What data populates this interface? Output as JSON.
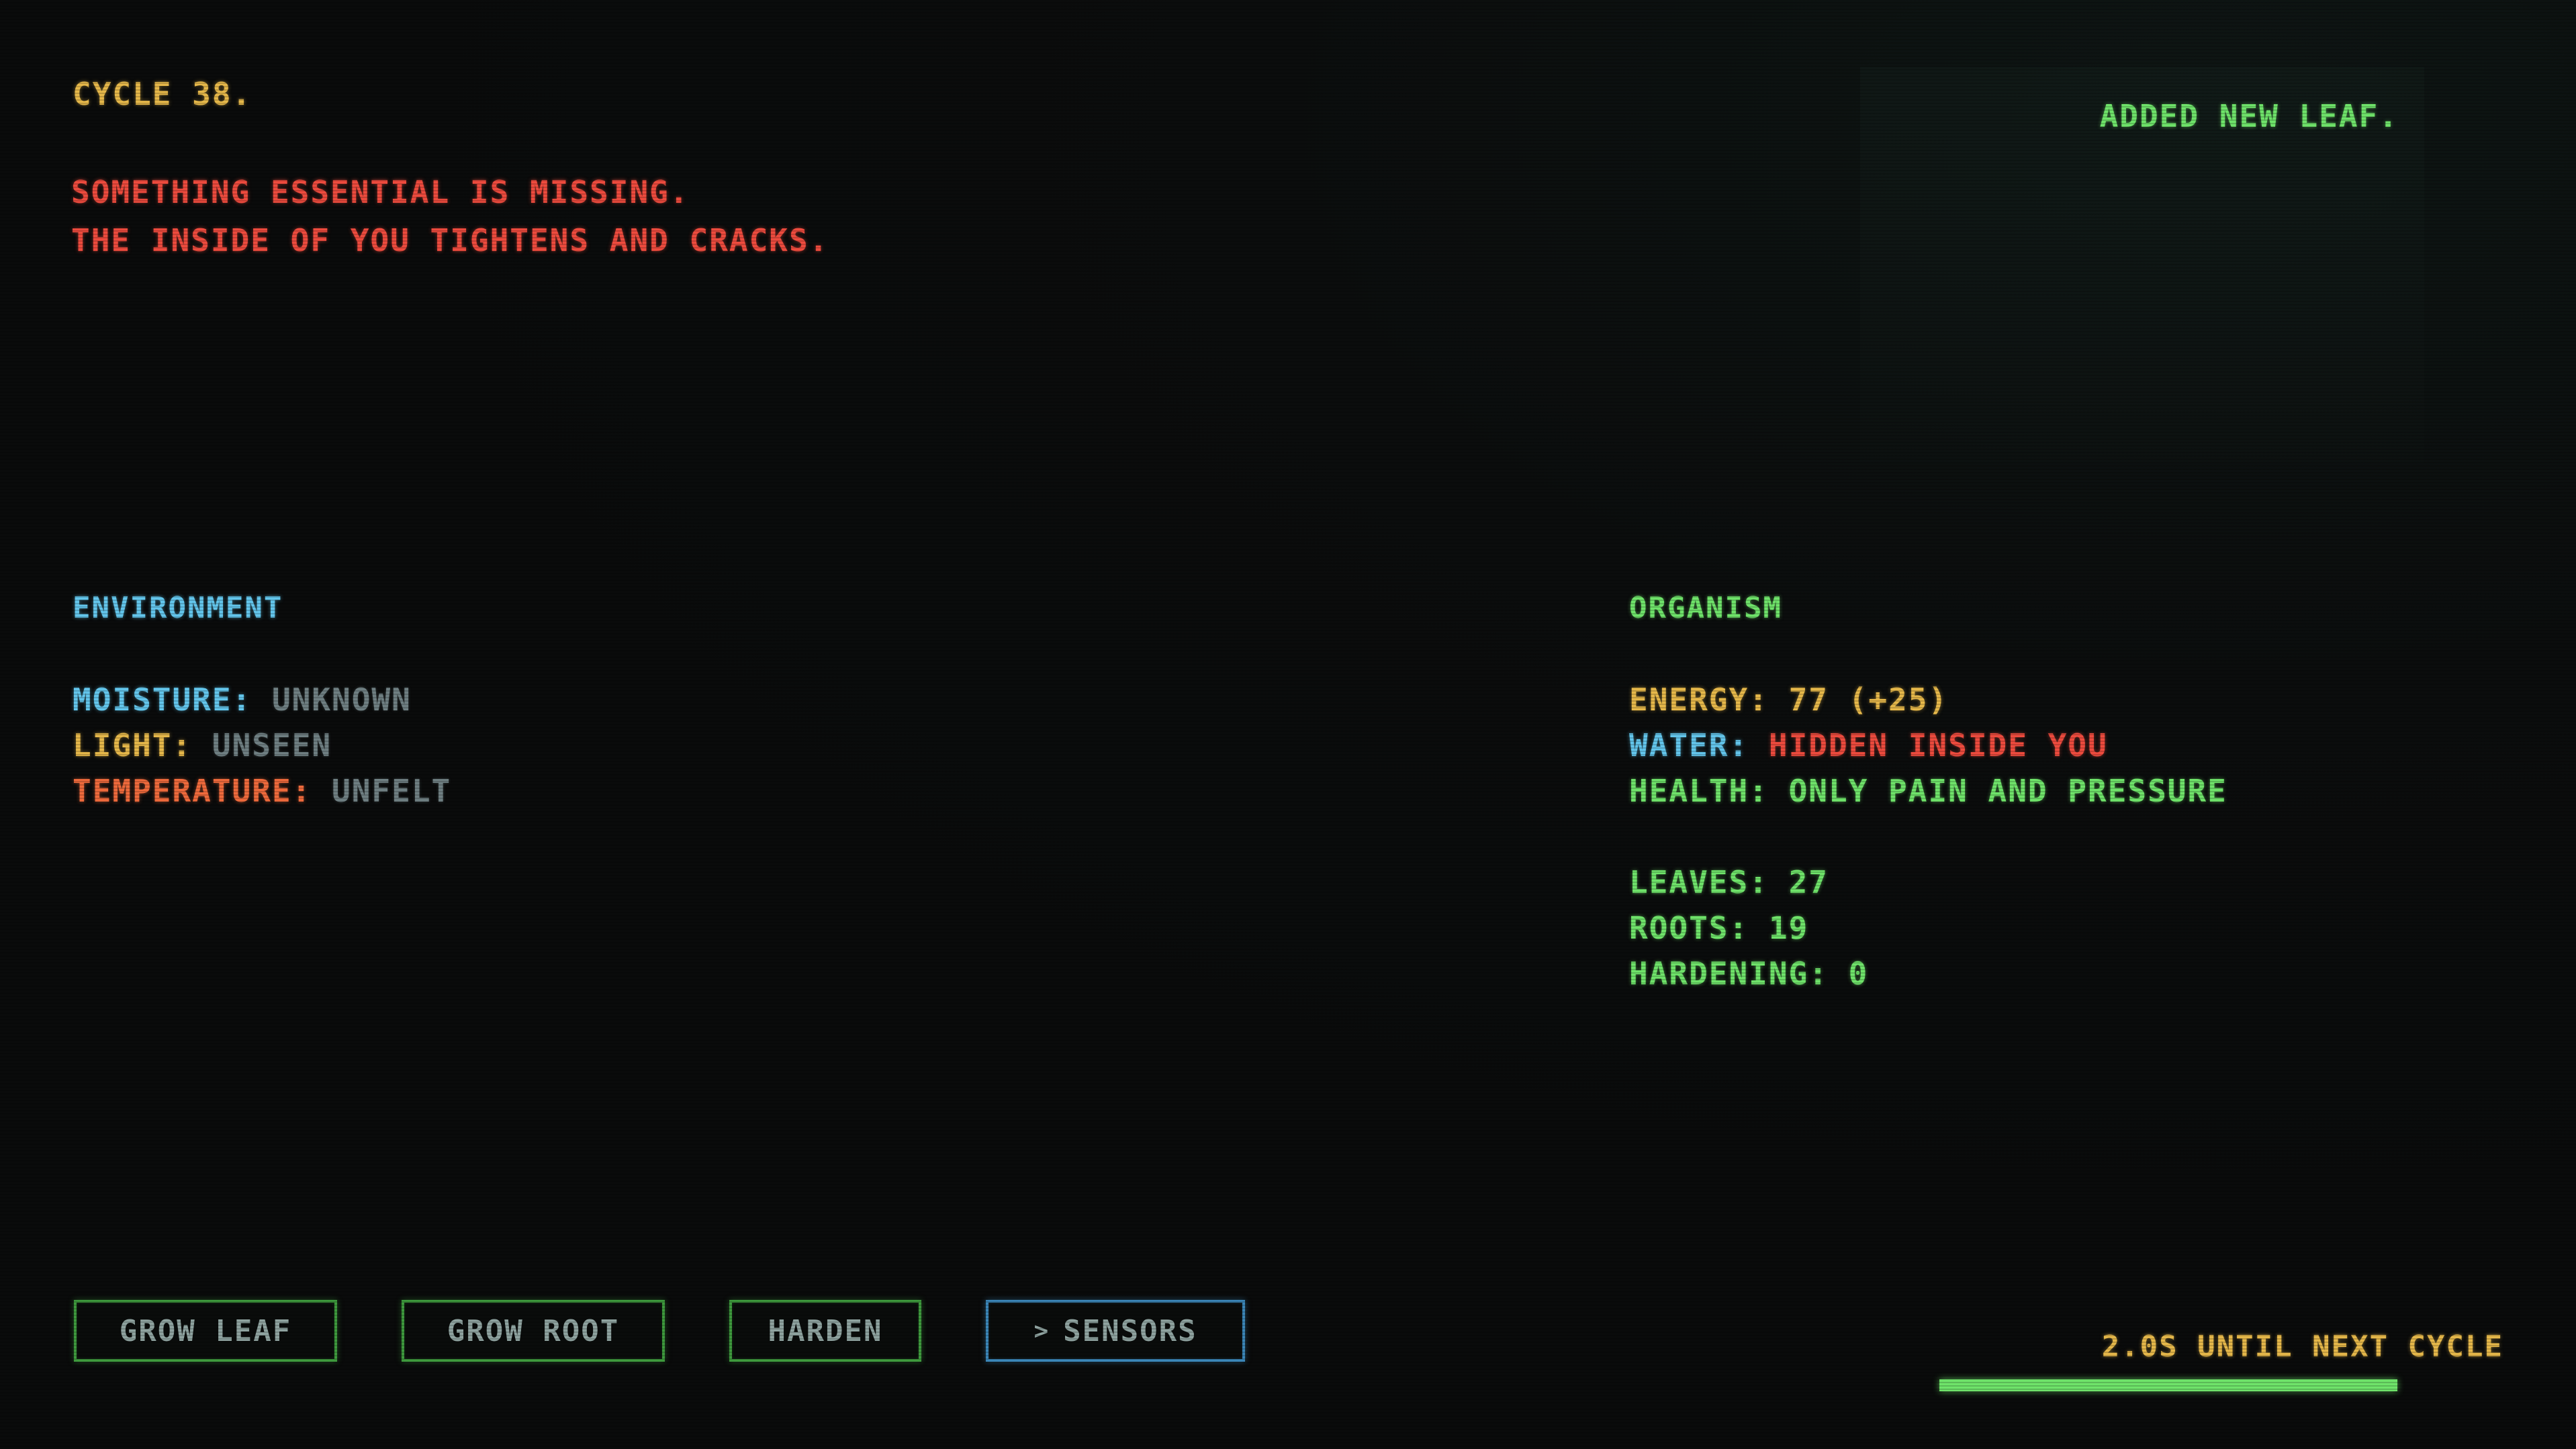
{
  "header": {
    "cycle_label": "CYCLE 38."
  },
  "messages": [
    "SOMETHING ESSENTIAL IS MISSING.",
    "THE INSIDE OF YOU TIGHTENS AND CRACKS."
  ],
  "log": {
    "latest": "ADDED NEW LEAF."
  },
  "environment": {
    "title": "ENVIRONMENT",
    "moisture": {
      "label": "MOISTURE:",
      "value": "UNKNOWN"
    },
    "light": {
      "label": "LIGHT:",
      "value": "UNSEEN"
    },
    "temperature": {
      "label": "TEMPERATURE:",
      "value": "UNFELT"
    }
  },
  "organism": {
    "title": "ORGANISM",
    "energy": {
      "label": "ENERGY:",
      "value": "77 (+25)"
    },
    "water": {
      "label": "WATER:",
      "value": "HIDDEN INSIDE YOU"
    },
    "health": {
      "label": "HEALTH:",
      "value": "ONLY PAIN AND PRESSURE"
    },
    "leaves": {
      "label": "LEAVES:",
      "value": "27"
    },
    "roots": {
      "label": "ROOTS:",
      "value": "19"
    },
    "hardening": {
      "label": "HARDENING:",
      "value": "0"
    }
  },
  "actions": {
    "grow_leaf": "GROW LEAF",
    "grow_root": "GROW ROOT",
    "harden": "HARDEN",
    "sensors": "SENSORS",
    "sensors_prefix": ">"
  },
  "timer": {
    "text": "2.0S UNTIL NEXT CYCLE",
    "progress": 1.0
  },
  "colors": {
    "background": "#0a0b0c",
    "yellow": "#e6b84a",
    "red": "#ee4b3e",
    "green": "#6fe36a",
    "blue": "#63c6ec",
    "orange": "#ef6a3c",
    "dim": "#6f7f82",
    "button_border_green": "#3e9a3d",
    "button_border_blue": "#3b86b8"
  }
}
